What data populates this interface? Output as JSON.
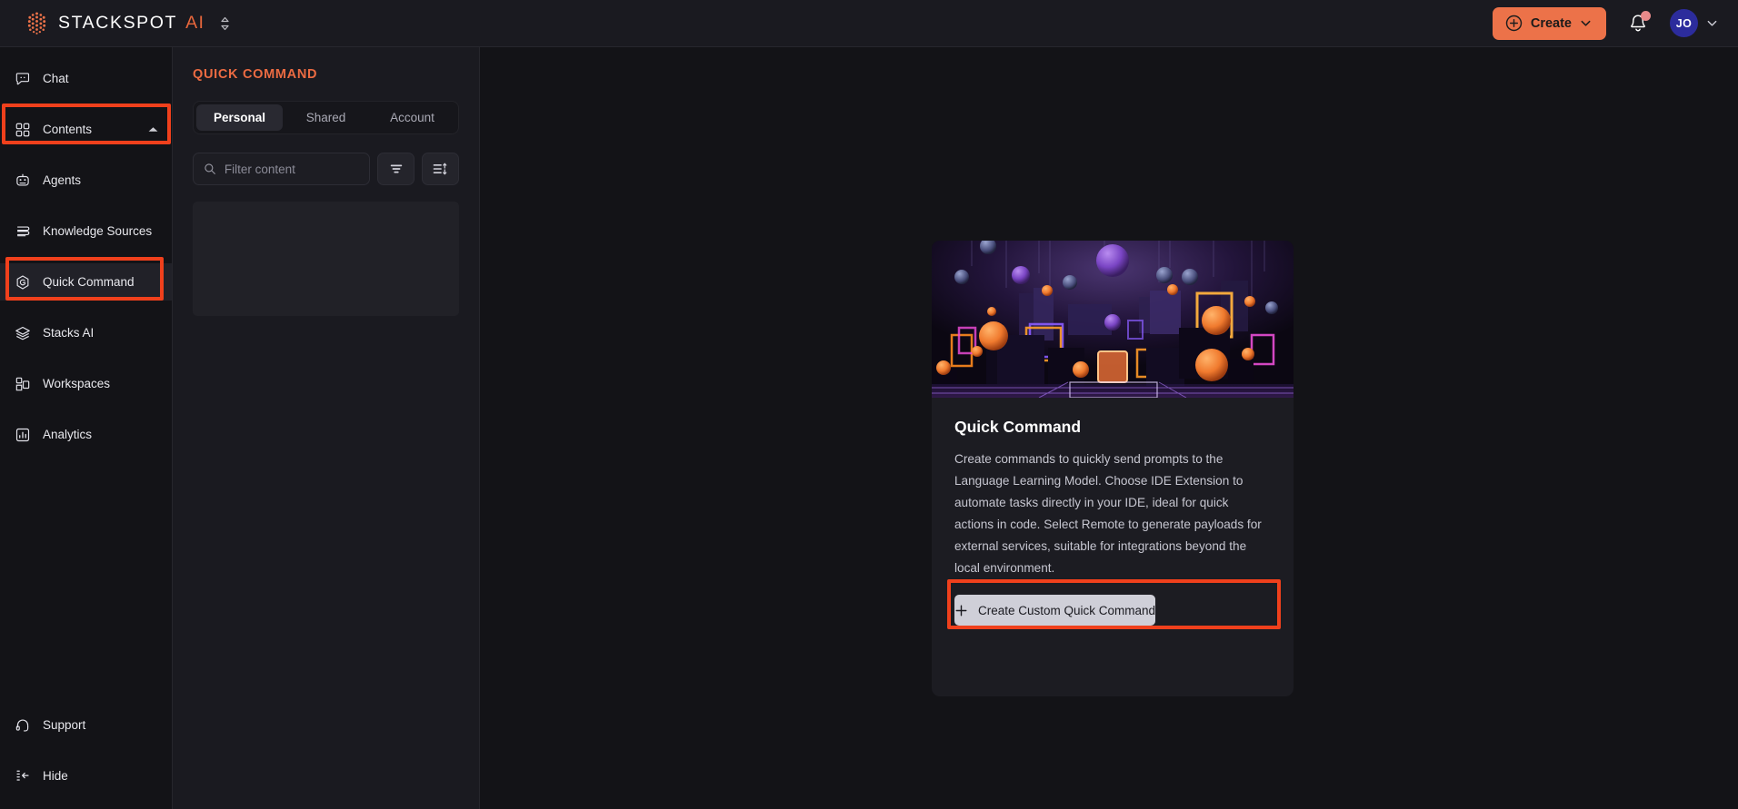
{
  "brand": {
    "word": "STACKSPOT",
    "ai": "AI",
    "logo_icon": "stackspot-hex-logo"
  },
  "topbar": {
    "create_label": "Create",
    "create_icon": "plus-circle-icon",
    "create_chevron_icon": "chevron-down-icon",
    "notifications_icon": "bell-icon",
    "avatar_initials": "JO",
    "avatar_chevron_icon": "chevron-down-icon",
    "accent_color": "#EC7249",
    "avatar_color": "#2C2C9C",
    "notification_dot_color": "#E88A8A"
  },
  "sidebar": {
    "items": [
      {
        "label": "Chat",
        "icon": "chat-bubble-icon",
        "active": false,
        "highlighted": false
      },
      {
        "label": "Contents",
        "icon": "grid-squares-icon",
        "active": false,
        "highlighted": true,
        "expanded": true,
        "chevron": "chevron-up-icon"
      },
      {
        "label": "Agents",
        "icon": "robot-icon",
        "active": false,
        "highlighted": false
      },
      {
        "label": "Knowledge Sources",
        "icon": "stacked-lines-icon",
        "active": false,
        "highlighted": false
      },
      {
        "label": "Quick Command",
        "icon": "hexagon-g-icon",
        "active": true,
        "highlighted": true
      },
      {
        "label": "Stacks AI",
        "icon": "layers-icon",
        "active": false,
        "highlighted": false
      },
      {
        "label": "Workspaces",
        "icon": "workspace-squares-icon",
        "active": false,
        "highlighted": false
      },
      {
        "label": "Analytics",
        "icon": "bar-chart-icon",
        "active": false,
        "highlighted": false
      }
    ],
    "bottom_items": [
      {
        "label": "Support",
        "icon": "headset-icon"
      },
      {
        "label": "Hide",
        "icon": "collapse-left-icon"
      }
    ]
  },
  "list_panel": {
    "title": "QUICK COMMAND",
    "title_color": "#EC6B42",
    "tabs": [
      {
        "label": "Personal",
        "active": true
      },
      {
        "label": "Shared",
        "active": false
      },
      {
        "label": "Account",
        "active": false
      }
    ],
    "search": {
      "placeholder": "Filter content",
      "value": "",
      "icon": "search-icon"
    },
    "filter_button_icon": "filter-funnel-icon",
    "sort_button_icon": "sort-list-icon"
  },
  "card": {
    "title": "Quick Command",
    "description": "Create commands to quickly send prompts to the Language Learning Model. Choose IDE Extension to automate tasks directly in your IDE, ideal for quick actions in code. Select Remote to generate payloads for external services, suitable for integrations beyond the local environment.",
    "cta_label": "Create Custom Quick Command",
    "cta_icon": "plus-icon",
    "hero_alt": "abstract-3d-neon-cubes-and-spheres"
  },
  "annotations": {
    "highlight_color": "#F0401C",
    "boxes": [
      "contents-nav-item",
      "quick-command-nav-item",
      "create-custom-quick-command-button"
    ]
  }
}
